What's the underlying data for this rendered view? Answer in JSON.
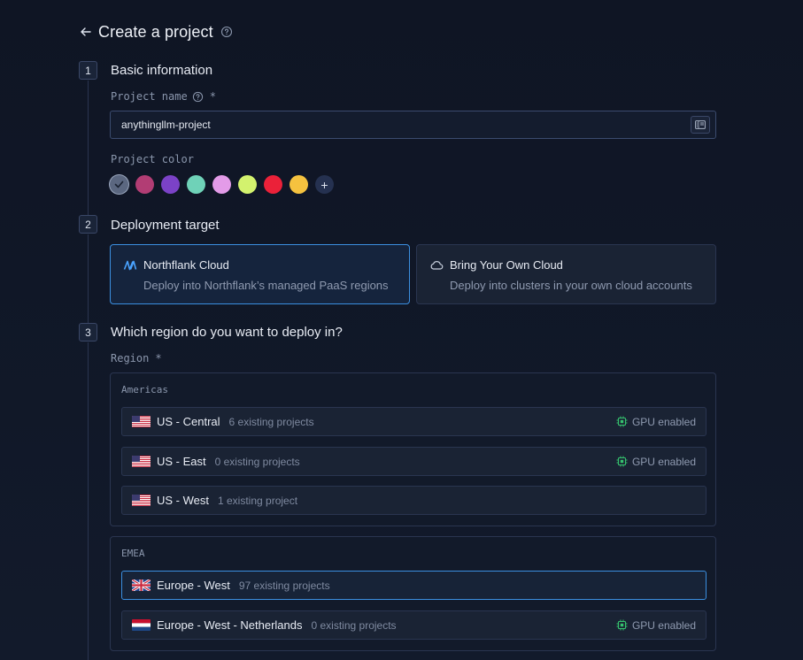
{
  "header": {
    "title": "Create a project"
  },
  "steps": [
    {
      "number": "1",
      "title": "Basic information"
    },
    {
      "number": "2",
      "title": "Deployment target"
    },
    {
      "number": "3",
      "title": "Which region do you want to deploy in?"
    }
  ],
  "project_name": {
    "label": "Project name",
    "required_mark": "*",
    "value": "anythingllm-project"
  },
  "project_color": {
    "label": "Project color",
    "swatches": [
      "#5b6780",
      "#b23d74",
      "#7b42c7",
      "#6fd2b8",
      "#e39be8",
      "#d3f26e",
      "#eb2139",
      "#f5c23f"
    ],
    "selected_index": 0,
    "add_label": "+"
  },
  "deployment": {
    "northflank": {
      "title": "Northflank Cloud",
      "desc": "Deploy into Northflank’s managed PaaS regions"
    },
    "byoc": {
      "title": "Bring Your Own Cloud",
      "desc": "Deploy into clusters in your own cloud accounts"
    }
  },
  "region": {
    "label": "Region",
    "required_mark": "*",
    "gpu_label": "GPU enabled",
    "groups": [
      {
        "name": "Americas",
        "rows": [
          {
            "name": "US - Central",
            "count": "6 existing projects",
            "gpu": true,
            "flag": "us"
          },
          {
            "name": "US - East",
            "count": "0 existing projects",
            "gpu": true,
            "flag": "us"
          },
          {
            "name": "US - West",
            "count": "1 existing project",
            "gpu": false,
            "flag": "us"
          }
        ]
      },
      {
        "name": "EMEA",
        "rows": [
          {
            "name": "Europe - West",
            "count": "97 existing projects",
            "gpu": false,
            "flag": "gb",
            "selected": true
          },
          {
            "name": "Europe - West - Netherlands",
            "count": "0 existing projects",
            "gpu": true,
            "flag": "nl"
          }
        ]
      }
    ]
  },
  "colors": {
    "accent": "#3b8fe0",
    "gpu": "#35c26e",
    "background": "#0f1524"
  }
}
